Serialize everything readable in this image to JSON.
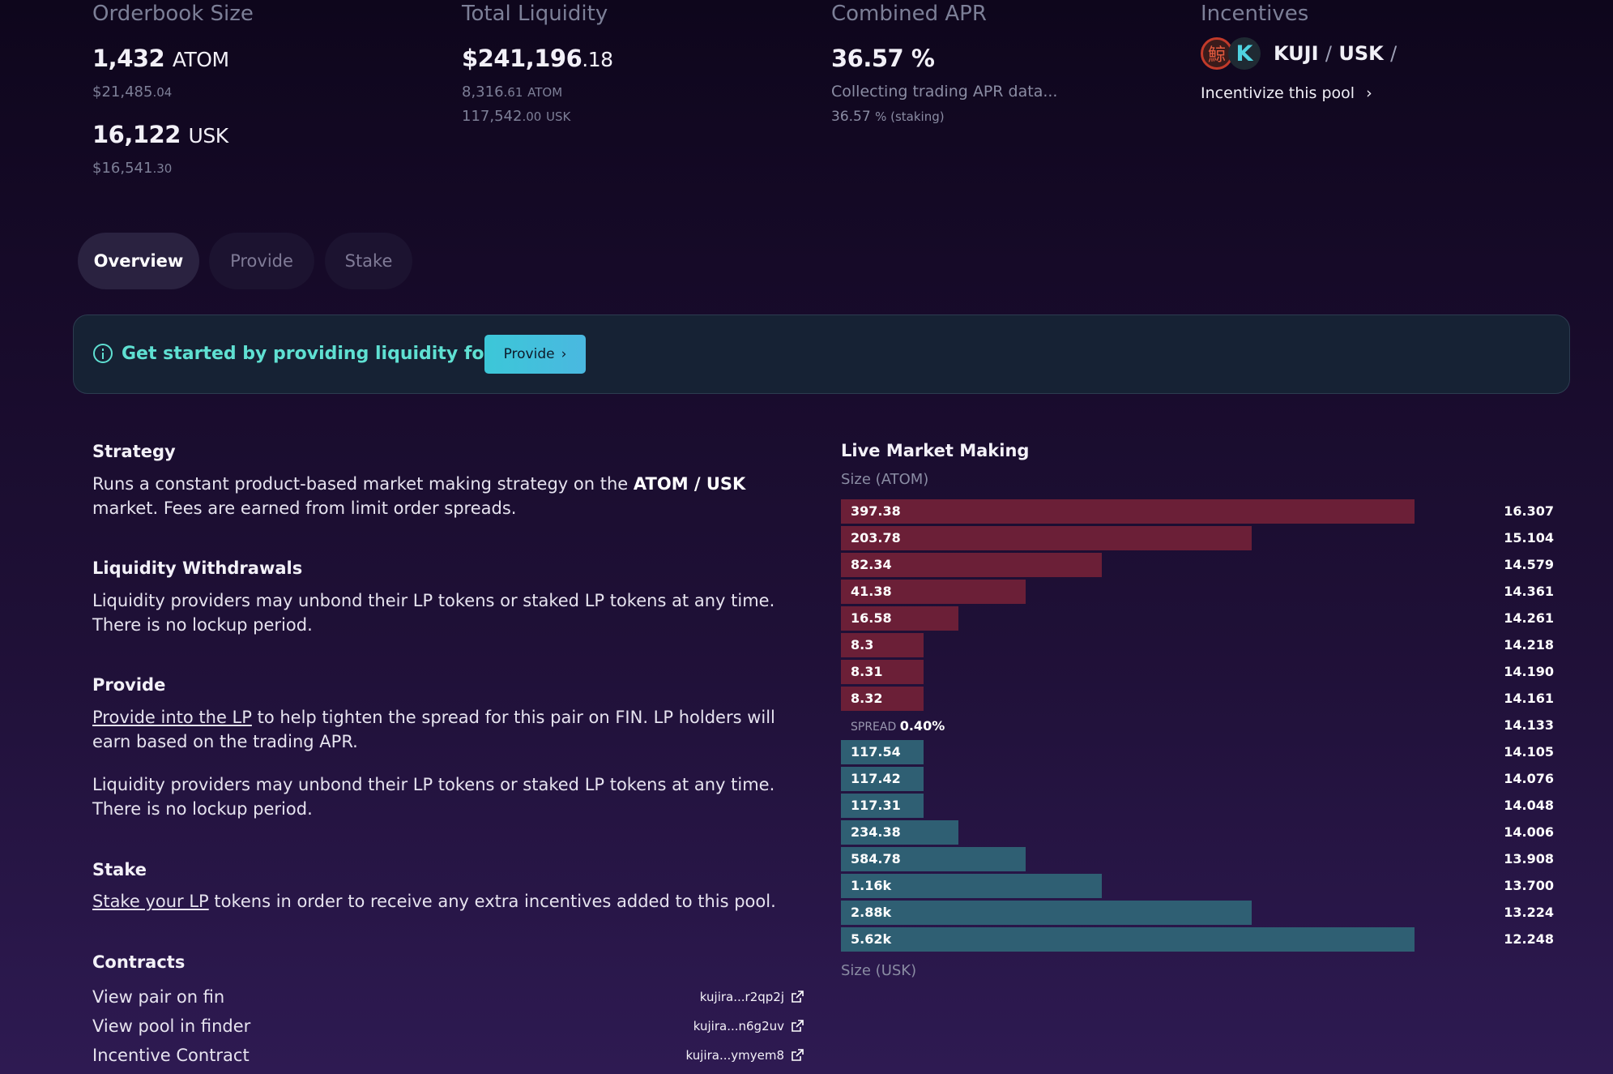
{
  "stats": {
    "orderbook": {
      "label": "Orderbook Size",
      "atom_value": "1,432",
      "atom_unit": "ATOM",
      "atom_usd": "$21,485",
      "atom_usd_dec": ".04",
      "usk_value": "16,122",
      "usk_unit": "USK",
      "usk_usd": "$16,541",
      "usk_usd_dec": ".30"
    },
    "liquidity": {
      "label": "Total Liquidity",
      "value": "$241,196",
      "value_dec": ".18",
      "atom": "8,316",
      "atom_dec": ".61",
      "atom_unit": "ATOM",
      "usk": "117,542",
      "usk_dec": ".00",
      "usk_unit": "USK"
    },
    "apr": {
      "label": "Combined APR",
      "value": "36.57 %",
      "trading": "Collecting trading APR data...",
      "staking": "36.57",
      "staking_suffix": "% (staking)"
    },
    "incentives": {
      "label": "Incentives",
      "pair_a": "KUJI",
      "pair_b": "USK",
      "sep": "/",
      "link": "Incentivize this pool"
    }
  },
  "tabs": {
    "overview": "Overview",
    "provide": "Provide",
    "stake": "Stake"
  },
  "banner": {
    "text": "Get started by providing liquidity for this pool",
    "button": "Provide"
  },
  "strategy": {
    "title": "Strategy",
    "text_a": "Runs a constant product-based market making strategy on the ",
    "text_bold": "ATOM / USK",
    "text_b": "market. Fees are earned from limit order spreads."
  },
  "withdrawals": {
    "title": "Liquidity Withdrawals",
    "line1": "Liquidity providers may unbond their LP tokens or staked LP tokens at any time.",
    "line2": "There is no lockup period."
  },
  "provide": {
    "title": "Provide",
    "link": "Provide into the LP",
    "text_a": " to help tighten the spread for this pair on FIN. LP holders will",
    "text_b": "earn based on the trading APR.",
    "line1": "Liquidity providers may unbond their LP tokens or staked LP tokens at any time.",
    "line2": "There is no lockup period."
  },
  "stake": {
    "title": "Stake",
    "link": "Stake your LP",
    "text": " tokens in order to receive any extra incentives added to this pool."
  },
  "contracts": {
    "title": "Contracts",
    "rows": [
      {
        "label": "View pair on fin",
        "addr": "kujira...r2qp2j"
      },
      {
        "label": "View pool in finder",
        "addr": "kujira...n6g2uv"
      },
      {
        "label": "Incentive Contract",
        "addr": "kujira...ymyem8"
      }
    ]
  },
  "chart_data": {
    "type": "bar",
    "title": "Live Market Making",
    "top_label": "Size (ATOM)",
    "bottom_label": "Size (USK)",
    "spread_label": "SPREAD",
    "spread_value": "0.40%",
    "asks": [
      {
        "size": 397.38,
        "label": "397.38",
        "price": "16.307"
      },
      {
        "size": 203.78,
        "label": "203.78",
        "price": "15.104"
      },
      {
        "size": 82.34,
        "label": "82.34",
        "price": "14.579"
      },
      {
        "size": 41.38,
        "label": "41.38",
        "price": "14.361"
      },
      {
        "size": 16.58,
        "label": "16.58",
        "price": "14.261"
      },
      {
        "size": 8.3,
        "label": "8.3",
        "price": "14.218"
      },
      {
        "size": 8.31,
        "label": "8.31",
        "price": "14.190"
      },
      {
        "size": 8.32,
        "label": "8.32",
        "price": "14.161"
      }
    ],
    "spread_price": "14.133",
    "bids": [
      {
        "size": 117.54,
        "label": "117.54",
        "price": "14.105"
      },
      {
        "size": 117.42,
        "label": "117.42",
        "price": "14.076"
      },
      {
        "size": 117.31,
        "label": "117.31",
        "price": "14.048"
      },
      {
        "size": 234.38,
        "label": "234.38",
        "price": "14.006"
      },
      {
        "size": 584.78,
        "label": "584.78",
        "price": "13.908"
      },
      {
        "size": 1160,
        "label": "1.16k",
        "price": "13.700"
      },
      {
        "size": 2880,
        "label": "2.88k",
        "price": "13.224"
      },
      {
        "size": 5620,
        "label": "5.62k",
        "price": "12.248"
      }
    ]
  }
}
